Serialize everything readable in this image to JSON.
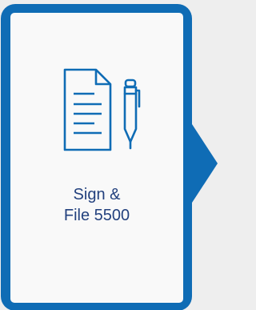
{
  "card": {
    "label_line1": "Sign &",
    "label_line2": "File 5500",
    "icon": "document-and-pen-icon"
  },
  "colors": {
    "frame": "#0f6cb5",
    "panel": "#f9f9f9",
    "text": "#23417e",
    "background": "#eeeeee"
  }
}
